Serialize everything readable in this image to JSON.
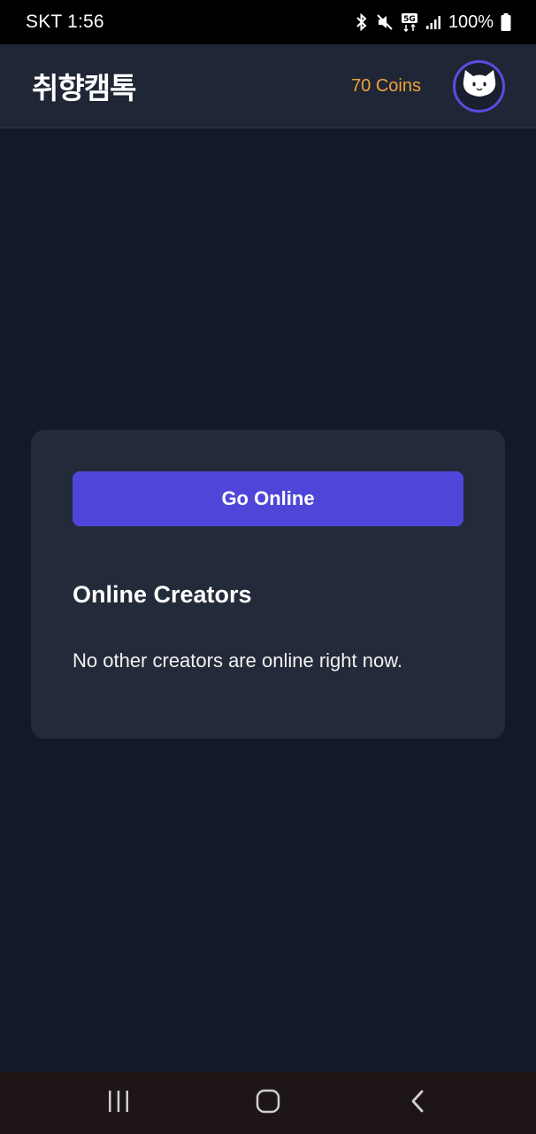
{
  "status_bar": {
    "carrier_time": "SKT 1:56",
    "battery": "100%",
    "icons": [
      "bluetooth-icon",
      "mute-icon",
      "5g-icon",
      "signal-icon",
      "battery-icon"
    ]
  },
  "header": {
    "title": "취향캠톡",
    "coins": "70 Coins",
    "avatar_icon": "cat-face-icon"
  },
  "card": {
    "go_online_label": "Go Online",
    "section_title": "Online Creators",
    "empty_message": "No other creators are online right now."
  },
  "nav": {
    "icons": [
      "recent-apps-icon",
      "home-icon",
      "back-icon"
    ]
  },
  "colors": {
    "background": "#141927",
    "header_bg": "#1f2635",
    "card_bg": "#232a39",
    "accent": "#4f45d8",
    "coins": "#f0a23a"
  }
}
